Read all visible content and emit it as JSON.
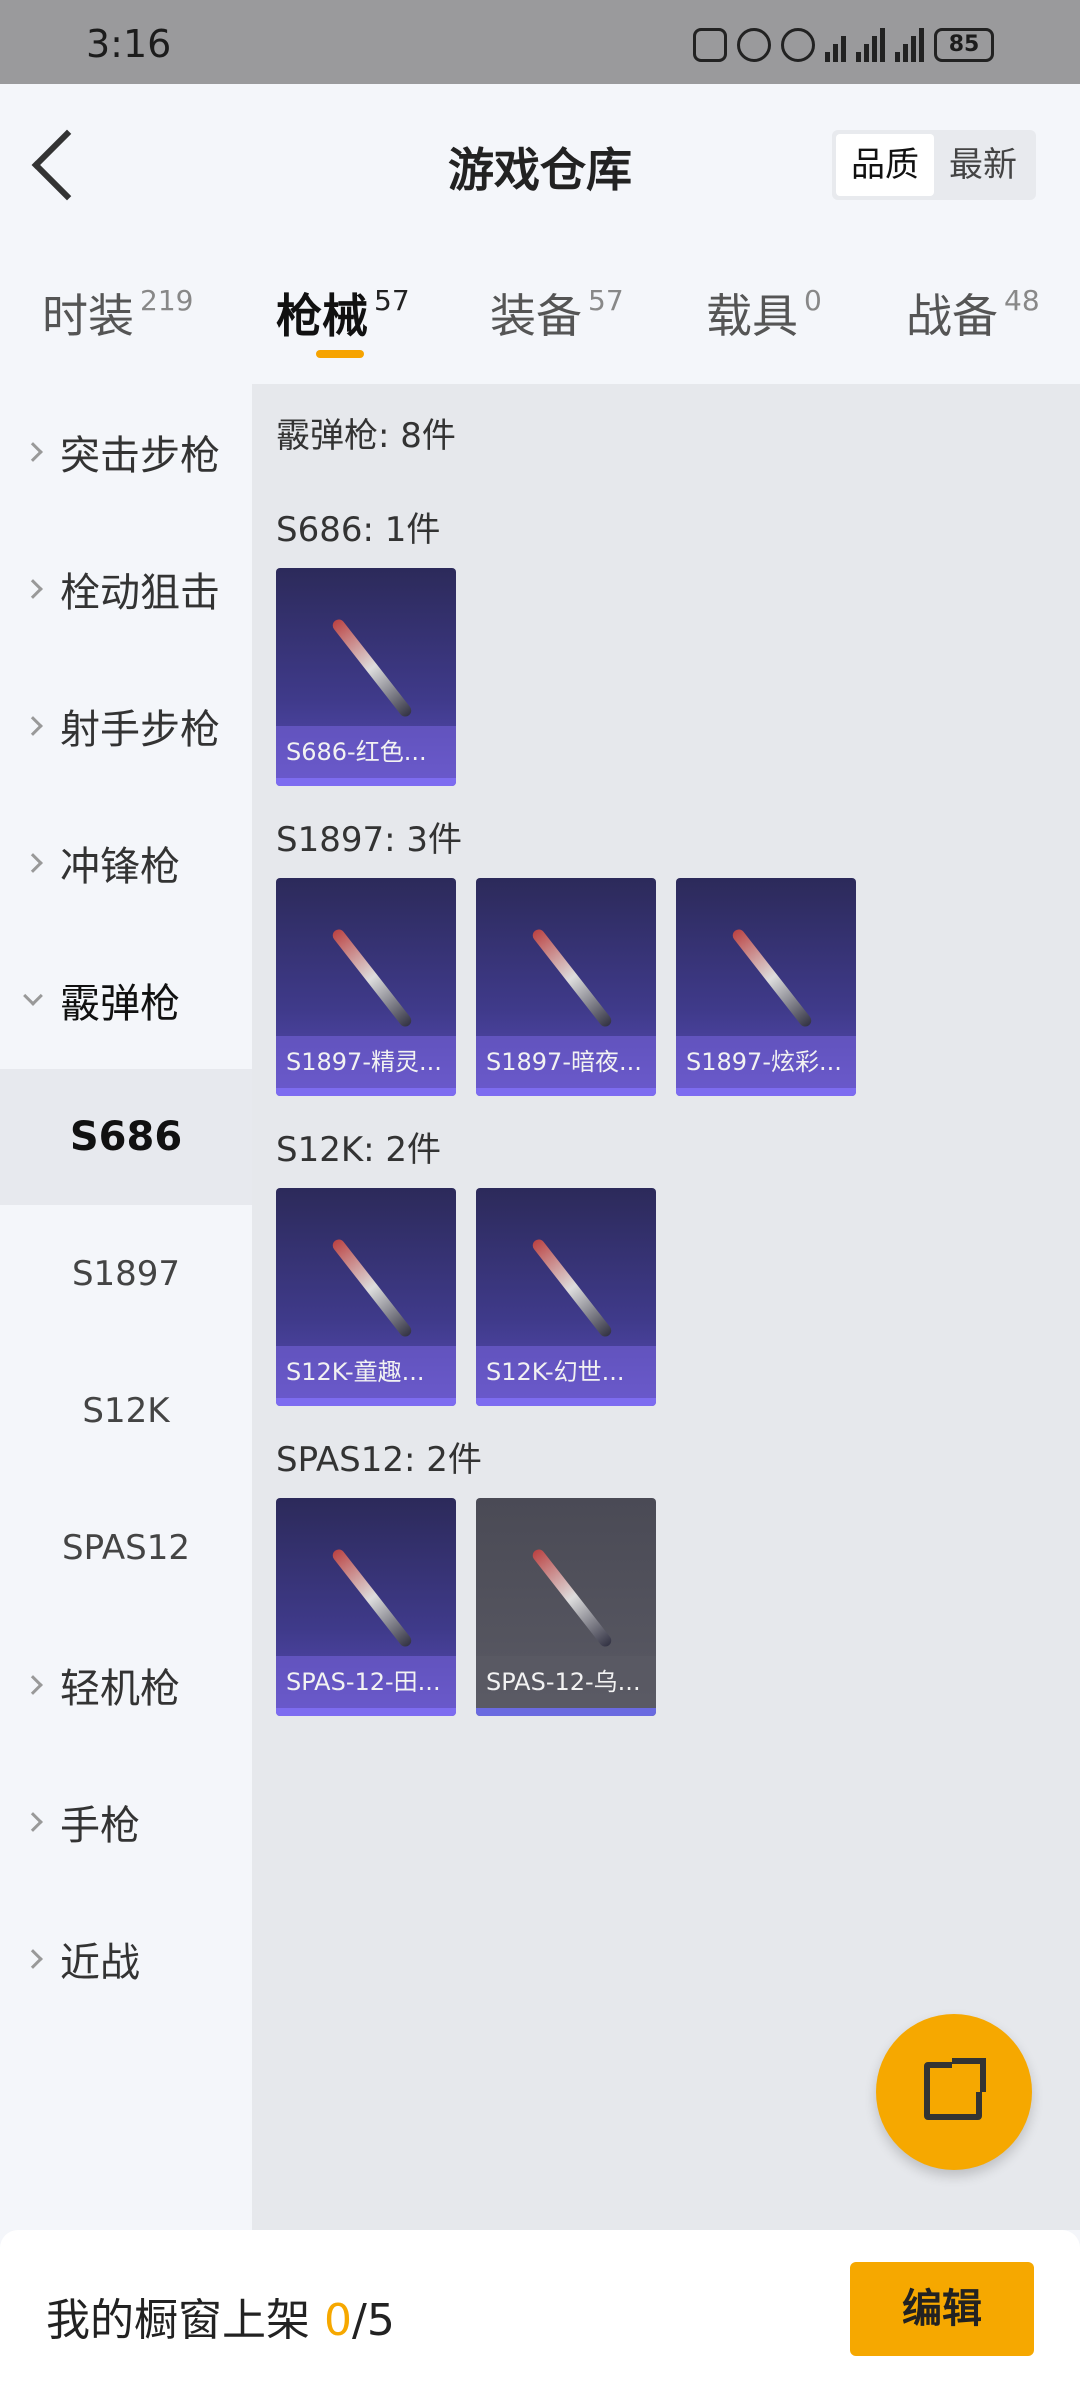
{
  "status": {
    "time": "3:16",
    "battery": "85"
  },
  "header": {
    "title": "游戏仓库",
    "sort": [
      "品质",
      "最新"
    ]
  },
  "tabs": [
    {
      "label": "时装",
      "count": "219"
    },
    {
      "label": "枪械",
      "count": "57"
    },
    {
      "label": "装备",
      "count": "57"
    },
    {
      "label": "载具",
      "count": "0"
    },
    {
      "label": "战备",
      "count": "48"
    }
  ],
  "sidebar": {
    "categories": [
      "突击步枪",
      "栓动狙击",
      "射手步枪",
      "冲锋枪",
      "霰弹枪",
      "轻机枪",
      "手枪",
      "近战"
    ],
    "subs": [
      "S686",
      "S1897",
      "S12K",
      "SPAS12"
    ]
  },
  "content": {
    "total": "霰弹枪: 8件",
    "sections": [
      {
        "title": "S686: 1件",
        "items": [
          "S686-红色..."
        ]
      },
      {
        "title": "S1897: 3件",
        "items": [
          "S1897-精灵...",
          "S1897-暗夜...",
          "S1897-炫彩..."
        ]
      },
      {
        "title": "S12K: 2件",
        "items": [
          "S12K-童趣...",
          "S12K-幻世..."
        ]
      },
      {
        "title": "SPAS12: 2件",
        "items": [
          "SPAS-12-田...",
          "SPAS-12-乌..."
        ]
      }
    ]
  },
  "bottom": {
    "shelf_label": "我的橱窗上架",
    "shelf_current": "0",
    "shelf_total": "/5",
    "edit": "编辑"
  },
  "colors": {
    "accent": "#f6a800",
    "card": "#3f3a8a"
  }
}
